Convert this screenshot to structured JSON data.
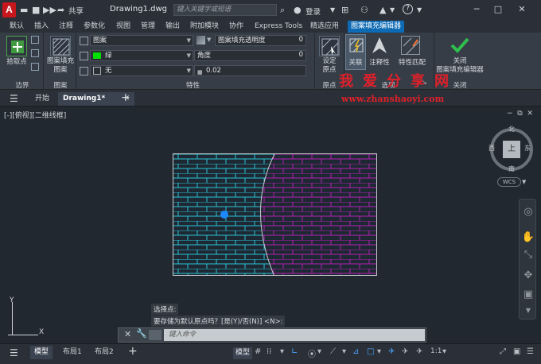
{
  "titlebar": {
    "logo": "A",
    "share": "共享",
    "doc_title": "Drawing1.dwg",
    "search_placeholder": "键入关键字或短语",
    "login": "登录",
    "help": "?"
  },
  "ribbon_tabs": [
    "默认",
    "插入",
    "注释",
    "参数化",
    "视图",
    "管理",
    "输出",
    "附加模块",
    "协作",
    "Express Tools",
    "精选应用",
    "图案填充编辑器"
  ],
  "active_ribbon_tab": "图案填充编辑器",
  "ribbon": {
    "pick_point": "拾取点",
    "boundary_panel": "边界",
    "pattern_btn": "图案填充\n图案",
    "pattern_panel": "图案",
    "props": {
      "type": "图案",
      "transparency_label": "图案填充透明度",
      "transparency_value": "0",
      "color": "绿",
      "angle_label": "角度",
      "angle_value": "0",
      "background": "无",
      "scale_value": "0.02"
    },
    "props_panel": "特性",
    "set_origin": "设定\n原点",
    "origin_panel": "原点",
    "associative": "关联",
    "annotative": "注释性",
    "match_props": "特性匹配",
    "options_panel": "选项",
    "close_btn": "关闭\n图案填充编辑器",
    "close_panel": "关闭"
  },
  "doc_tabs": {
    "start": "开始",
    "drawing": "Drawing1*"
  },
  "viewport_label": "[-][俯视][二维线框]",
  "compass": {
    "north": "北",
    "south": "南",
    "east": "东",
    "west": "西",
    "top": "上",
    "wcs": "WCS"
  },
  "ucs": {
    "x": "X",
    "y": "Y"
  },
  "command": {
    "history_1": "选择点:",
    "history_2": "要存储为默认原点吗？[是(Y)/否(N)] <N>:",
    "placeholder": "键入命令"
  },
  "status": {
    "model_tab": "模型",
    "layout1": "布局1",
    "layout2": "布局2",
    "model_btn": "模型",
    "scale": "1:1"
  },
  "watermark": {
    "cn": "我爱分享网",
    "url": "www.zhanshaoyi.com"
  },
  "colors": {
    "accent": "#0d6ab4",
    "hatch_left": "#29c4d8",
    "hatch_right": "#b41fb4",
    "origin_dot": "#1e88ff",
    "watermark": "#e0202a"
  }
}
